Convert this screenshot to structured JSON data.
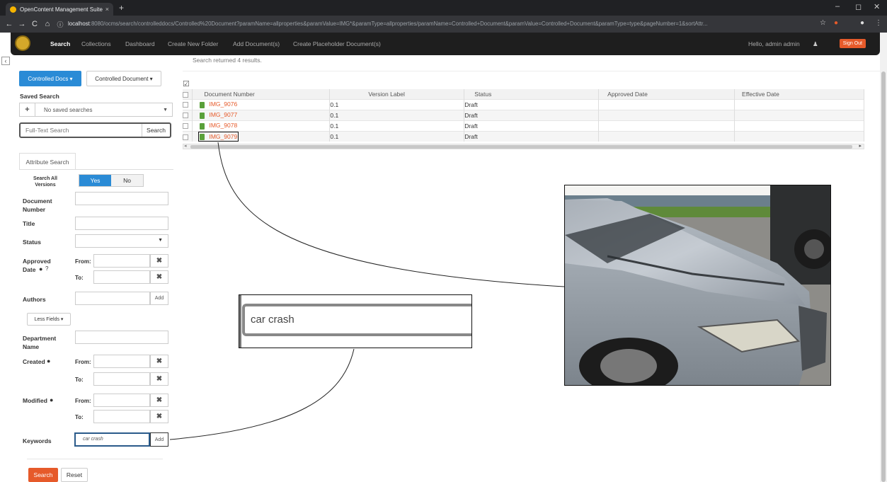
{
  "browser": {
    "tab_title": "OpenContent Management Suite",
    "tab_close": "×",
    "new_tab": "+",
    "url_host": "localhost",
    "url_rest": ":8080/ocms/search/controlleddocs/Controlled%20Document?paramName=allproperties&paramValue=IMG*&paramType=allproperties/paramName=Controlled+Document&paramValue=Controlled+Document&paramType=type&pageNumber=1&sortAttr...",
    "win_min": "–",
    "win_max": "◻",
    "win_close": "✕"
  },
  "nav": {
    "search": "Search",
    "collections": "Collections",
    "dashboard": "Dashboard",
    "create_folder": "Create New Folder",
    "add_documents": "Add Document(s)",
    "create_placeholder": "Create Placeholder Document(s)",
    "greeting": "Hello, admin admin",
    "sign_out": "Sign Out"
  },
  "sidebar": {
    "doc_type_btn": "Controlled Docs ▾",
    "doc_subtype_btn": "Controlled Document ▾",
    "saved_search_label": "Saved Search",
    "saved_search_value": "No saved searches",
    "fulltext_placeholder": "Full-Text Search",
    "fulltext_button": "Search",
    "attr_tab": "Attribute Search",
    "search_all_versions": "Search All Versions",
    "yes": "Yes",
    "no": "No",
    "doc_number": "Document Number",
    "title": "Title",
    "status": "Status",
    "approved_date": "Approved Date",
    "from": "From:",
    "to": "To:",
    "authors": "Authors",
    "add": "Add",
    "less_fields": "Less Fields ▾",
    "department": "Department Name",
    "created": "Created",
    "modified": "Modified",
    "keywords": "Keywords",
    "keywords_value": "car crash",
    "search_btn": "Search",
    "reset_btn": "Reset"
  },
  "results": {
    "message": "Search returned 4 results.",
    "columns": [
      "Document Number",
      "Version Label",
      "Status",
      "Approved Date",
      "Effective Date"
    ],
    "rows": [
      {
        "number": "IMG_9076",
        "version": "0.1",
        "status": "Draft"
      },
      {
        "number": "IMG_9077",
        "version": "0.1",
        "status": "Draft"
      },
      {
        "number": "IMG_9078",
        "version": "0.1",
        "status": "Draft"
      },
      {
        "number": "IMG_9079",
        "version": "0.1",
        "status": "Draft"
      }
    ]
  },
  "callout": {
    "zoom_text": "car crash"
  },
  "colors": {
    "accent_orange": "#e65a2a",
    "accent_blue": "#2a8bd6",
    "nav_bg": "#1e1e1e"
  }
}
